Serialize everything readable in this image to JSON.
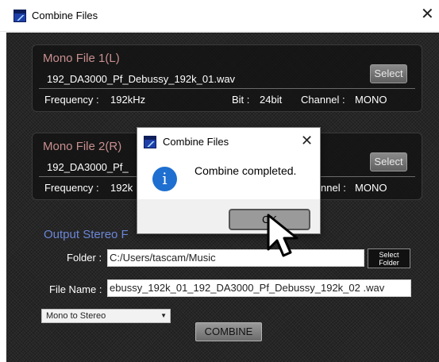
{
  "window": {
    "title": "Combine Files",
    "close_glyph": "✕"
  },
  "mono1": {
    "title": "Mono File 1(L)",
    "filename": "192_DA3000_Pf_Debussy_192k_01.wav",
    "frequency_label": "Frequency :",
    "frequency_value": "192kHz",
    "bit_label": "Bit :",
    "bit_value": "24bit",
    "channel_label": "Channel :",
    "channel_value": "MONO",
    "select_label": "Select"
  },
  "mono2": {
    "title": "Mono File 2(R)",
    "filename": "192_DA3000_Pf_",
    "frequency_label": "Frequency :",
    "frequency_value": "192k",
    "channel_label": "nnel :",
    "channel_value": "MONO",
    "select_label": "Select"
  },
  "output": {
    "title": "Output Stereo F",
    "folder_label": "Folder :",
    "folder_value": "C:/Users/tascam/Music",
    "select_folder_line1": "Select",
    "select_folder_line2": "Folder",
    "filename_label": "File Name :",
    "filename_value": "ebussy_192k_01_192_DA3000_Pf_Debussy_192k_02 .wav",
    "mode_value": "Mono to Stereo",
    "mode_arrow": "▼",
    "combine_label": "COMBINE"
  },
  "dialog": {
    "title": "Combine Files",
    "close_glyph": "✕",
    "icon": "info-icon",
    "icon_glyph": "i",
    "message": "Combine completed.",
    "ok_label": "OK"
  },
  "colors": {
    "panel_title": "#c98f8f",
    "output_title": "#6b86d6",
    "info_blue": "#1e6fd0",
    "client_bg": "#262626"
  }
}
